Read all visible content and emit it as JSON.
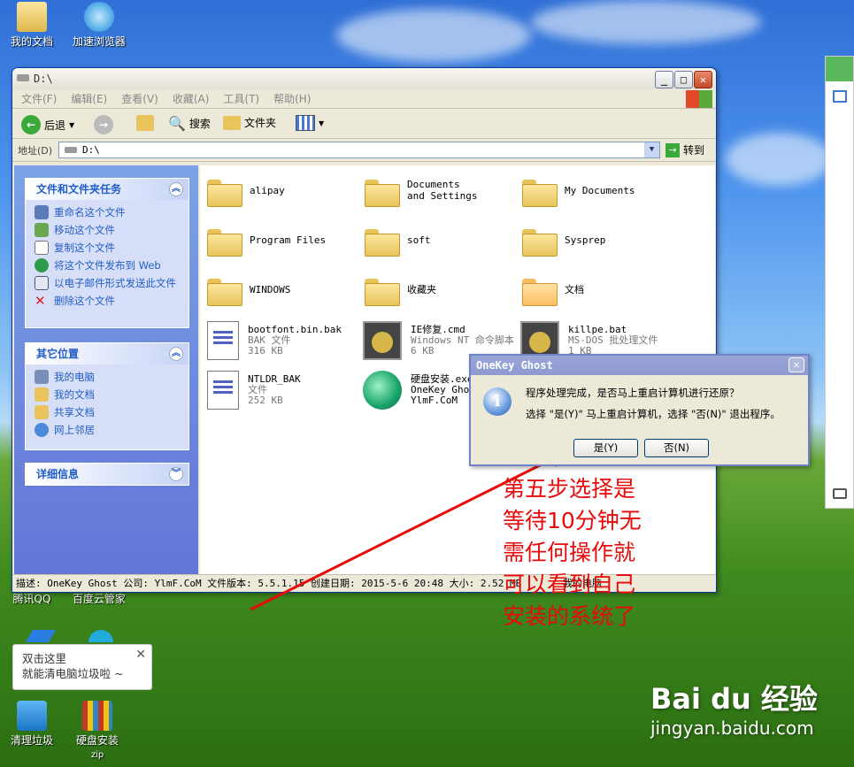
{
  "desktop": {
    "icons": [
      {
        "label": "我的文档",
        "icon": "my-documents-icon"
      },
      {
        "label": "加速浏览器",
        "icon": "browser-icon"
      },
      {
        "label": "腾讯QQ",
        "icon": "qq-icon"
      },
      {
        "label": "百度云管家",
        "icon": "baidu-cloud-icon"
      },
      {
        "label": "清理垃圾",
        "icon": "cleanup-icon"
      },
      {
        "label": "硬盘安装",
        "sublabel": "zip",
        "icon": "archive-icon"
      }
    ],
    "tooltip": {
      "line1": "双击这里",
      "line2": "就能清电脑垃圾啦 ~"
    }
  },
  "window": {
    "title": "D:\\",
    "menu": [
      "文件(F)",
      "编辑(E)",
      "查看(V)",
      "收藏(A)",
      "工具(T)",
      "帮助(H)"
    ],
    "toolbar": {
      "back": "后退",
      "search": "搜索",
      "folders": "文件夹"
    },
    "address": {
      "label": "地址(D)",
      "value": "D:\\",
      "go": "转到"
    },
    "left_pane": {
      "tasks": {
        "title": "文件和文件夹任务",
        "items": [
          "重命名这个文件",
          "移动这个文件",
          "复制这个文件",
          "将这个文件发布到 Web",
          "以电子邮件形式发送此文件",
          "删除这个文件"
        ]
      },
      "places": {
        "title": "其它位置",
        "items": [
          "我的电脑",
          "我的文档",
          "共享文档",
          "网上邻居"
        ]
      },
      "details": {
        "title": "详细信息"
      }
    },
    "files": [
      {
        "name": "alipay",
        "type": "folder"
      },
      {
        "name": "Documents and Settings",
        "type": "folder"
      },
      {
        "name": "My Documents",
        "type": "folder"
      },
      {
        "name": "Program Files",
        "type": "folder"
      },
      {
        "name": "soft",
        "type": "folder"
      },
      {
        "name": "Sysprep",
        "type": "folder"
      },
      {
        "name": "WINDOWS",
        "type": "folder"
      },
      {
        "name": "收藏夹",
        "type": "folder"
      },
      {
        "name": "文档",
        "type": "folder"
      },
      {
        "name": "bootfont.bin.bak",
        "desc": "BAK 文件",
        "size": "316 KB",
        "type": "doc"
      },
      {
        "name": "IE修复.cmd",
        "desc": "Windows NT 命令脚本",
        "size": "6 KB",
        "type": "cmd"
      },
      {
        "name": "killpe.bat",
        "desc": "MS-DOS 批处理文件",
        "size": "1 KB",
        "type": "cmd"
      },
      {
        "name": "NTLDR_BAK",
        "desc": "文件",
        "size": "252 KB",
        "type": "doc"
      },
      {
        "name": "硬盘安装.exe",
        "desc": "OneKey Ghost",
        "size": "YlmF.CoM",
        "type": "ghost"
      }
    ],
    "status": "描述: OneKey Ghost 公司: YlmF.CoM 文件版本: 5.5.1.15 创建日期: 2015-5-6 20:48 大小: 2.52 MB",
    "status_right": "我的电脑"
  },
  "dialog": {
    "title": "OneKey Ghost",
    "line1": "程序处理完成，是否马上重启计算机进行还原？",
    "line2": "选择 \"是(Y)\" 马上重启计算机，选择 \"否(N)\" 退出程序。",
    "yes": "是(Y)",
    "no": "否(N)"
  },
  "annotation": {
    "lines": [
      "第五步选择是",
      "等待10分钟无",
      "需任何操作就",
      "可以看到自己",
      "安装的系统了"
    ]
  },
  "watermark": {
    "brand": "Bai du 经验",
    "url": "jingyan.baidu.com"
  },
  "colors": {
    "xp_blue": "#0a3aa0",
    "link_blue": "#215dc6",
    "annotation_red": "#e80a0a",
    "dialog_title": "#8e9ad0"
  }
}
